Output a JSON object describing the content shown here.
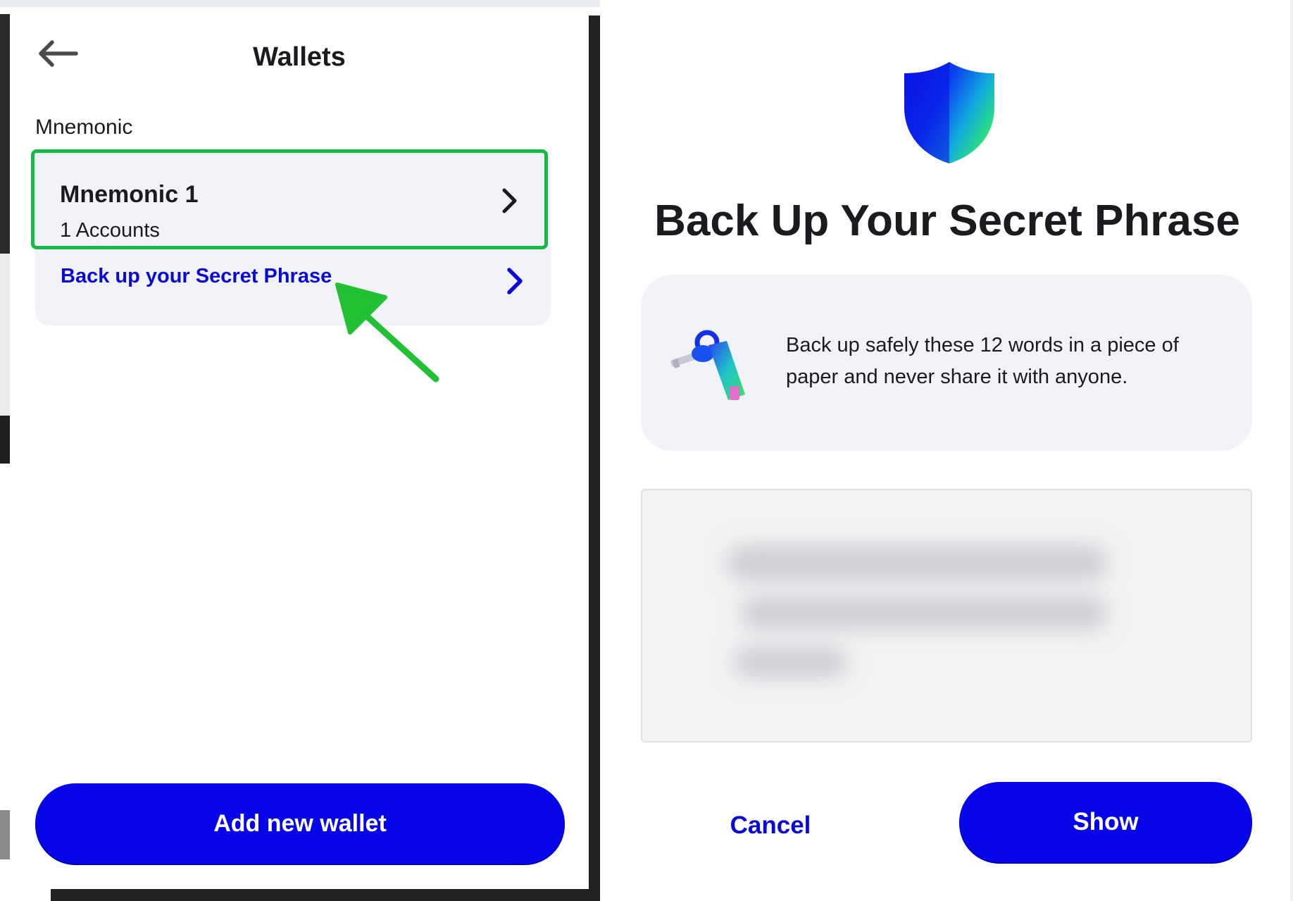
{
  "wallets_panel": {
    "title": "Wallets",
    "back_icon": "arrow-left-icon",
    "section_label": "Mnemonic",
    "wallet_item": {
      "name": "Mnemonic 1",
      "accounts": "1 Accounts",
      "chevron_icon": "chevron-right-icon"
    },
    "backup_link": {
      "label": "Back up your Secret Phrase",
      "chevron_icon": "chevron-right-icon"
    },
    "add_wallet_label": "Add new wallet"
  },
  "backup_dialog": {
    "shield_icon": "shield-icon",
    "title": "Back Up Your Secret Phrase",
    "key_icon": "keys-icon",
    "info_text": "Back up safely these 12 words in a piece of paper and never share it with anyone.",
    "cancel_label": "Cancel",
    "show_label": "Show"
  },
  "colors": {
    "accent_blue": "#0505e8",
    "link_blue": "#0a0ad6",
    "highlight_green": "#16b846",
    "card_bg": "#f2f3f8"
  }
}
